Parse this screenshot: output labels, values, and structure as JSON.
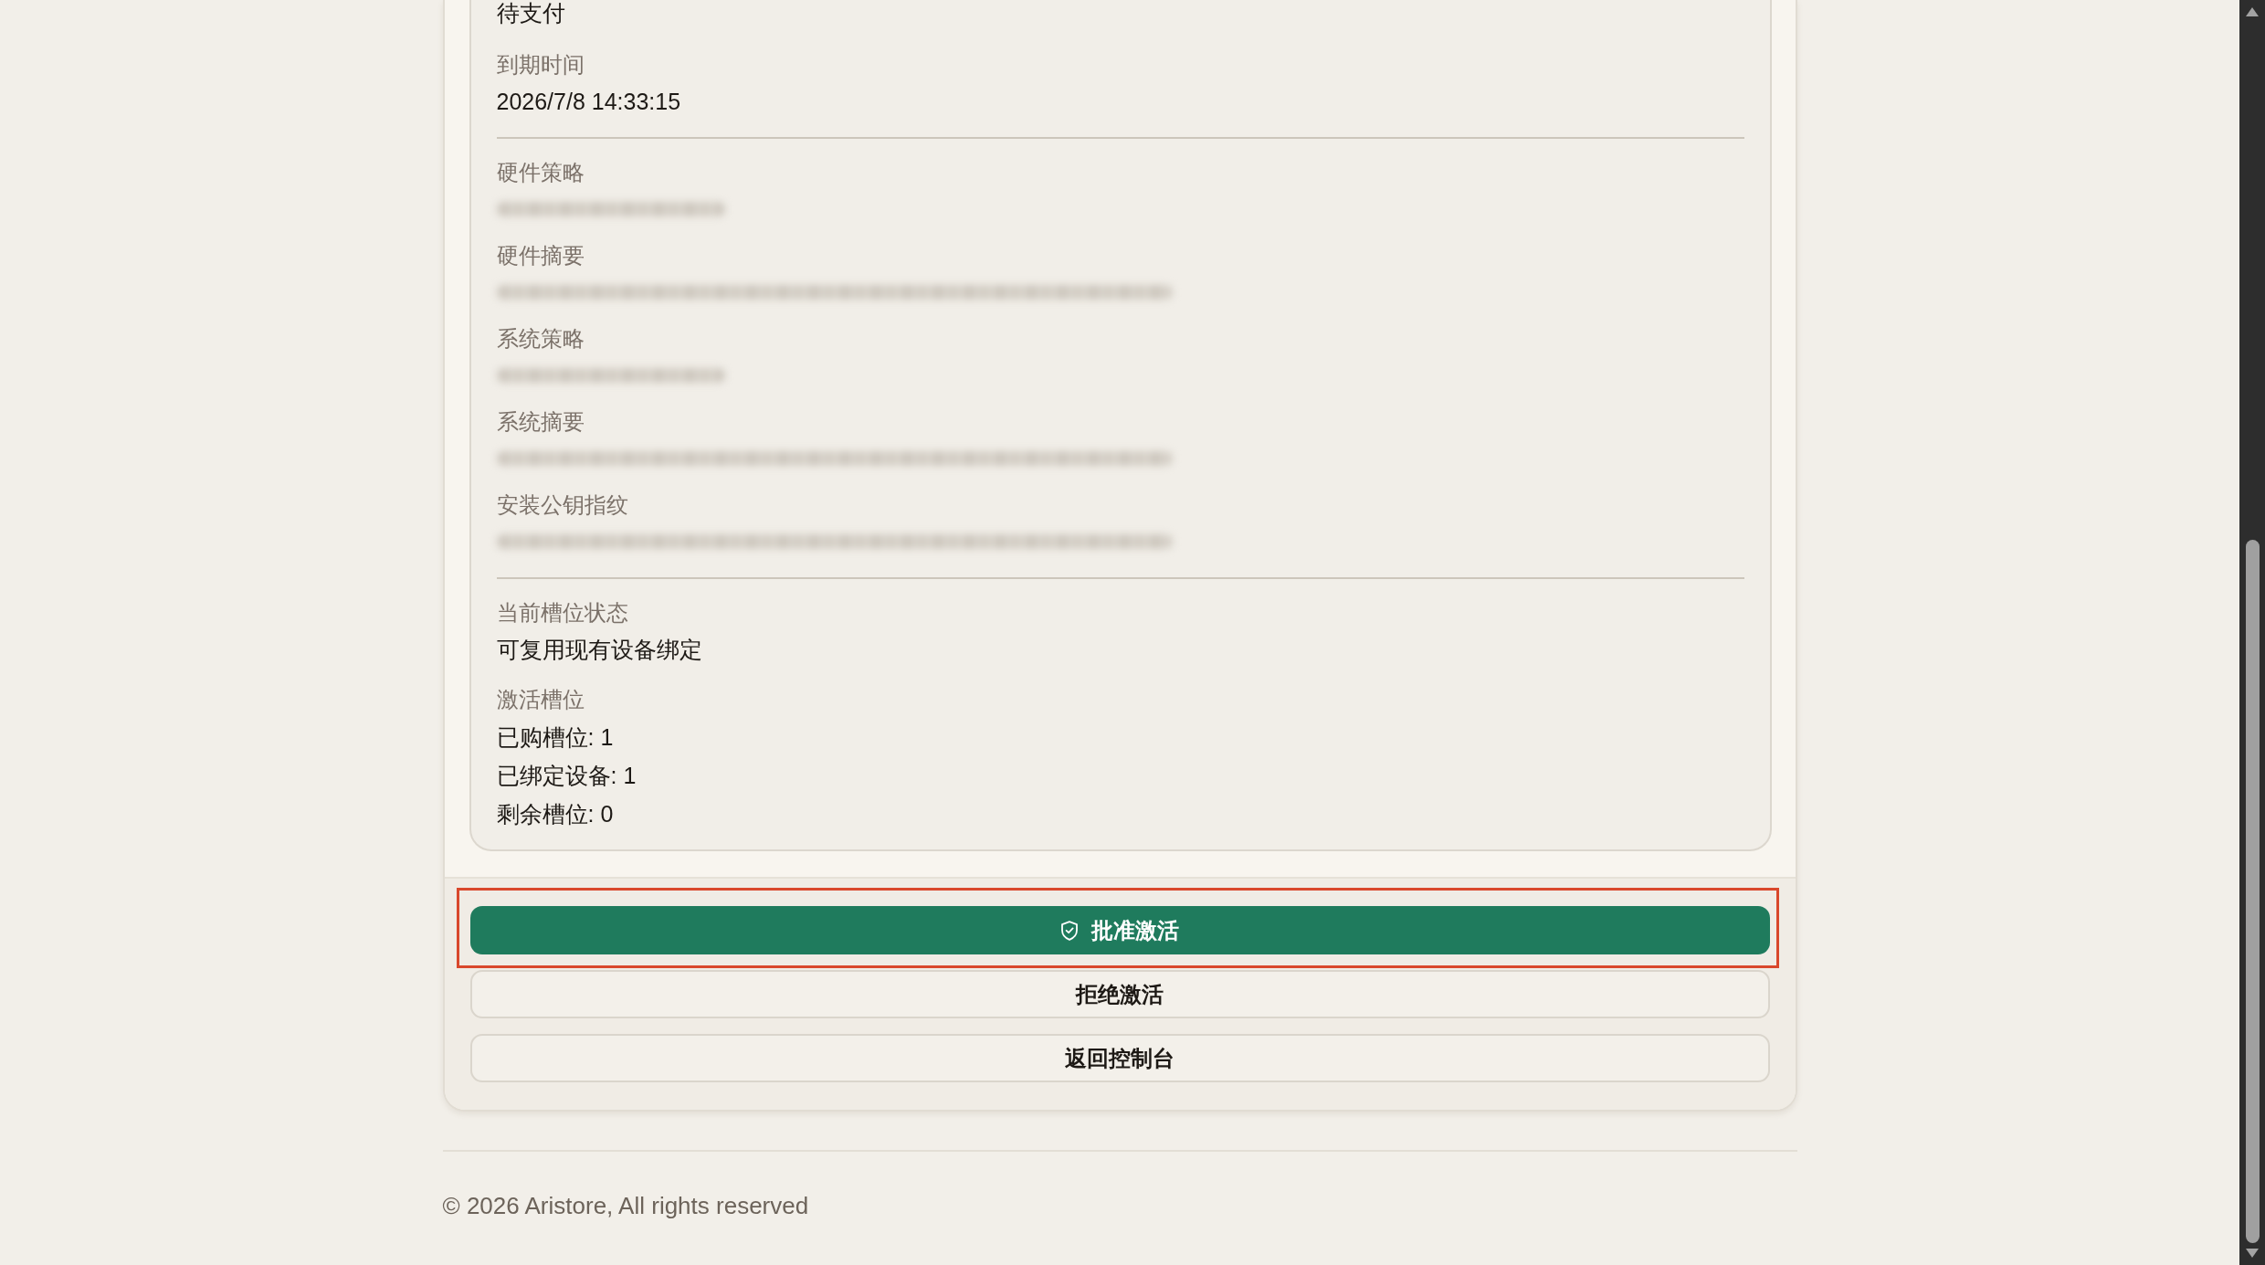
{
  "details": {
    "sections": [
      {
        "fields": [
          {
            "kind": "text",
            "value": "待支付"
          },
          {
            "kind": "text",
            "label": "到期时间",
            "value": "2026/7/8 14:33:15"
          }
        ]
      },
      {
        "fields": [
          {
            "kind": "masked_short",
            "label": "硬件策略"
          },
          {
            "kind": "masked_long",
            "label": "硬件摘要"
          },
          {
            "kind": "masked_short",
            "label": "系统策略"
          },
          {
            "kind": "masked_long",
            "label": "系统摘要"
          },
          {
            "kind": "masked_long",
            "label": "安装公钥指纹"
          }
        ]
      },
      {
        "fields": [
          {
            "kind": "text",
            "label": "当前槽位状态",
            "value": "可复用现有设备绑定"
          },
          {
            "kind": "list",
            "label": "激活槽位",
            "lines": [
              "已购槽位: 1",
              "已绑定设备: 1",
              "剩余槽位: 0"
            ]
          }
        ]
      }
    ]
  },
  "actions": [
    {
      "kind": "primary",
      "label": "批准激活",
      "highlighted": true
    },
    {
      "kind": "secondary",
      "label": "拒绝激活"
    },
    {
      "kind": "secondary",
      "label": "返回控制台"
    }
  ],
  "footer": {
    "copyright": "© 2026 Aristore, All rights reserved"
  }
}
